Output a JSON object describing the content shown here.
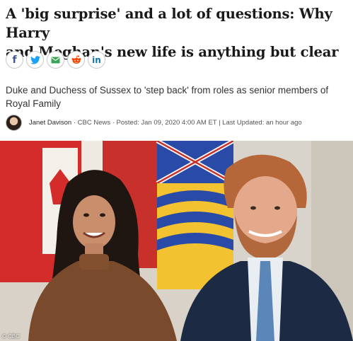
{
  "article": {
    "headline_line1": "A 'big surprise' and a lot of questions: Why Harry",
    "headline_line2": "and Meghan's new life is anything but clear",
    "subtitle": "Duke and Duchess of Sussex to 'step back' from roles as senior members of Royal Family",
    "author": "Janet Davison",
    "meta": " · CBC News · Posted: Jan 09, 2020 4:00 AM ET | Last Updated: an hour ago"
  },
  "share": {
    "facebook_glyph": "f",
    "linkedin_glyph": "in",
    "buttons": [
      "facebook-icon",
      "twitter-icon",
      "email-icon",
      "reddit-icon",
      "linkedin-icon"
    ]
  },
  "photo": {
    "credit": "© CBC"
  },
  "colors": {
    "facebook": "#3b5998",
    "twitter": "#1da1f2",
    "email": "#3aa655",
    "reddit": "#ff4500",
    "linkedin": "#0e76a8"
  }
}
